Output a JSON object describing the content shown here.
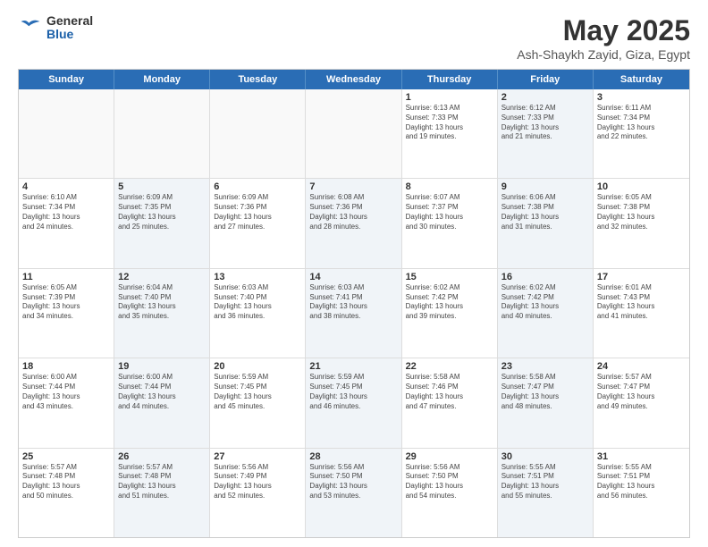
{
  "logo": {
    "general": "General",
    "blue": "Blue"
  },
  "header": {
    "title": "May 2025",
    "subtitle": "Ash-Shaykh Zayid, Giza, Egypt"
  },
  "weekdays": [
    "Sunday",
    "Monday",
    "Tuesday",
    "Wednesday",
    "Thursday",
    "Friday",
    "Saturday"
  ],
  "rows": [
    [
      {
        "day": "",
        "lines": [],
        "empty": true
      },
      {
        "day": "",
        "lines": [],
        "empty": true
      },
      {
        "day": "",
        "lines": [],
        "empty": true
      },
      {
        "day": "",
        "lines": [],
        "empty": true
      },
      {
        "day": "1",
        "lines": [
          "Sunrise: 6:13 AM",
          "Sunset: 7:33 PM",
          "Daylight: 13 hours",
          "and 19 minutes."
        ]
      },
      {
        "day": "2",
        "lines": [
          "Sunrise: 6:12 AM",
          "Sunset: 7:33 PM",
          "Daylight: 13 hours",
          "and 21 minutes."
        ],
        "shaded": true
      },
      {
        "day": "3",
        "lines": [
          "Sunrise: 6:11 AM",
          "Sunset: 7:34 PM",
          "Daylight: 13 hours",
          "and 22 minutes."
        ]
      }
    ],
    [
      {
        "day": "4",
        "lines": [
          "Sunrise: 6:10 AM",
          "Sunset: 7:34 PM",
          "Daylight: 13 hours",
          "and 24 minutes."
        ]
      },
      {
        "day": "5",
        "lines": [
          "Sunrise: 6:09 AM",
          "Sunset: 7:35 PM",
          "Daylight: 13 hours",
          "and 25 minutes."
        ],
        "shaded": true
      },
      {
        "day": "6",
        "lines": [
          "Sunrise: 6:09 AM",
          "Sunset: 7:36 PM",
          "Daylight: 13 hours",
          "and 27 minutes."
        ]
      },
      {
        "day": "7",
        "lines": [
          "Sunrise: 6:08 AM",
          "Sunset: 7:36 PM",
          "Daylight: 13 hours",
          "and 28 minutes."
        ],
        "shaded": true
      },
      {
        "day": "8",
        "lines": [
          "Sunrise: 6:07 AM",
          "Sunset: 7:37 PM",
          "Daylight: 13 hours",
          "and 30 minutes."
        ]
      },
      {
        "day": "9",
        "lines": [
          "Sunrise: 6:06 AM",
          "Sunset: 7:38 PM",
          "Daylight: 13 hours",
          "and 31 minutes."
        ],
        "shaded": true
      },
      {
        "day": "10",
        "lines": [
          "Sunrise: 6:05 AM",
          "Sunset: 7:38 PM",
          "Daylight: 13 hours",
          "and 32 minutes."
        ]
      }
    ],
    [
      {
        "day": "11",
        "lines": [
          "Sunrise: 6:05 AM",
          "Sunset: 7:39 PM",
          "Daylight: 13 hours",
          "and 34 minutes."
        ]
      },
      {
        "day": "12",
        "lines": [
          "Sunrise: 6:04 AM",
          "Sunset: 7:40 PM",
          "Daylight: 13 hours",
          "and 35 minutes."
        ],
        "shaded": true
      },
      {
        "day": "13",
        "lines": [
          "Sunrise: 6:03 AM",
          "Sunset: 7:40 PM",
          "Daylight: 13 hours",
          "and 36 minutes."
        ]
      },
      {
        "day": "14",
        "lines": [
          "Sunrise: 6:03 AM",
          "Sunset: 7:41 PM",
          "Daylight: 13 hours",
          "and 38 minutes."
        ],
        "shaded": true
      },
      {
        "day": "15",
        "lines": [
          "Sunrise: 6:02 AM",
          "Sunset: 7:42 PM",
          "Daylight: 13 hours",
          "and 39 minutes."
        ]
      },
      {
        "day": "16",
        "lines": [
          "Sunrise: 6:02 AM",
          "Sunset: 7:42 PM",
          "Daylight: 13 hours",
          "and 40 minutes."
        ],
        "shaded": true
      },
      {
        "day": "17",
        "lines": [
          "Sunrise: 6:01 AM",
          "Sunset: 7:43 PM",
          "Daylight: 13 hours",
          "and 41 minutes."
        ]
      }
    ],
    [
      {
        "day": "18",
        "lines": [
          "Sunrise: 6:00 AM",
          "Sunset: 7:44 PM",
          "Daylight: 13 hours",
          "and 43 minutes."
        ]
      },
      {
        "day": "19",
        "lines": [
          "Sunrise: 6:00 AM",
          "Sunset: 7:44 PM",
          "Daylight: 13 hours",
          "and 44 minutes."
        ],
        "shaded": true
      },
      {
        "day": "20",
        "lines": [
          "Sunrise: 5:59 AM",
          "Sunset: 7:45 PM",
          "Daylight: 13 hours",
          "and 45 minutes."
        ]
      },
      {
        "day": "21",
        "lines": [
          "Sunrise: 5:59 AM",
          "Sunset: 7:45 PM",
          "Daylight: 13 hours",
          "and 46 minutes."
        ],
        "shaded": true
      },
      {
        "day": "22",
        "lines": [
          "Sunrise: 5:58 AM",
          "Sunset: 7:46 PM",
          "Daylight: 13 hours",
          "and 47 minutes."
        ]
      },
      {
        "day": "23",
        "lines": [
          "Sunrise: 5:58 AM",
          "Sunset: 7:47 PM",
          "Daylight: 13 hours",
          "and 48 minutes."
        ],
        "shaded": true
      },
      {
        "day": "24",
        "lines": [
          "Sunrise: 5:57 AM",
          "Sunset: 7:47 PM",
          "Daylight: 13 hours",
          "and 49 minutes."
        ]
      }
    ],
    [
      {
        "day": "25",
        "lines": [
          "Sunrise: 5:57 AM",
          "Sunset: 7:48 PM",
          "Daylight: 13 hours",
          "and 50 minutes."
        ]
      },
      {
        "day": "26",
        "lines": [
          "Sunrise: 5:57 AM",
          "Sunset: 7:48 PM",
          "Daylight: 13 hours",
          "and 51 minutes."
        ],
        "shaded": true
      },
      {
        "day": "27",
        "lines": [
          "Sunrise: 5:56 AM",
          "Sunset: 7:49 PM",
          "Daylight: 13 hours",
          "and 52 minutes."
        ]
      },
      {
        "day": "28",
        "lines": [
          "Sunrise: 5:56 AM",
          "Sunset: 7:50 PM",
          "Daylight: 13 hours",
          "and 53 minutes."
        ],
        "shaded": true
      },
      {
        "day": "29",
        "lines": [
          "Sunrise: 5:56 AM",
          "Sunset: 7:50 PM",
          "Daylight: 13 hours",
          "and 54 minutes."
        ]
      },
      {
        "day": "30",
        "lines": [
          "Sunrise: 5:55 AM",
          "Sunset: 7:51 PM",
          "Daylight: 13 hours",
          "and 55 minutes."
        ],
        "shaded": true
      },
      {
        "day": "31",
        "lines": [
          "Sunrise: 5:55 AM",
          "Sunset: 7:51 PM",
          "Daylight: 13 hours",
          "and 56 minutes."
        ]
      }
    ]
  ]
}
